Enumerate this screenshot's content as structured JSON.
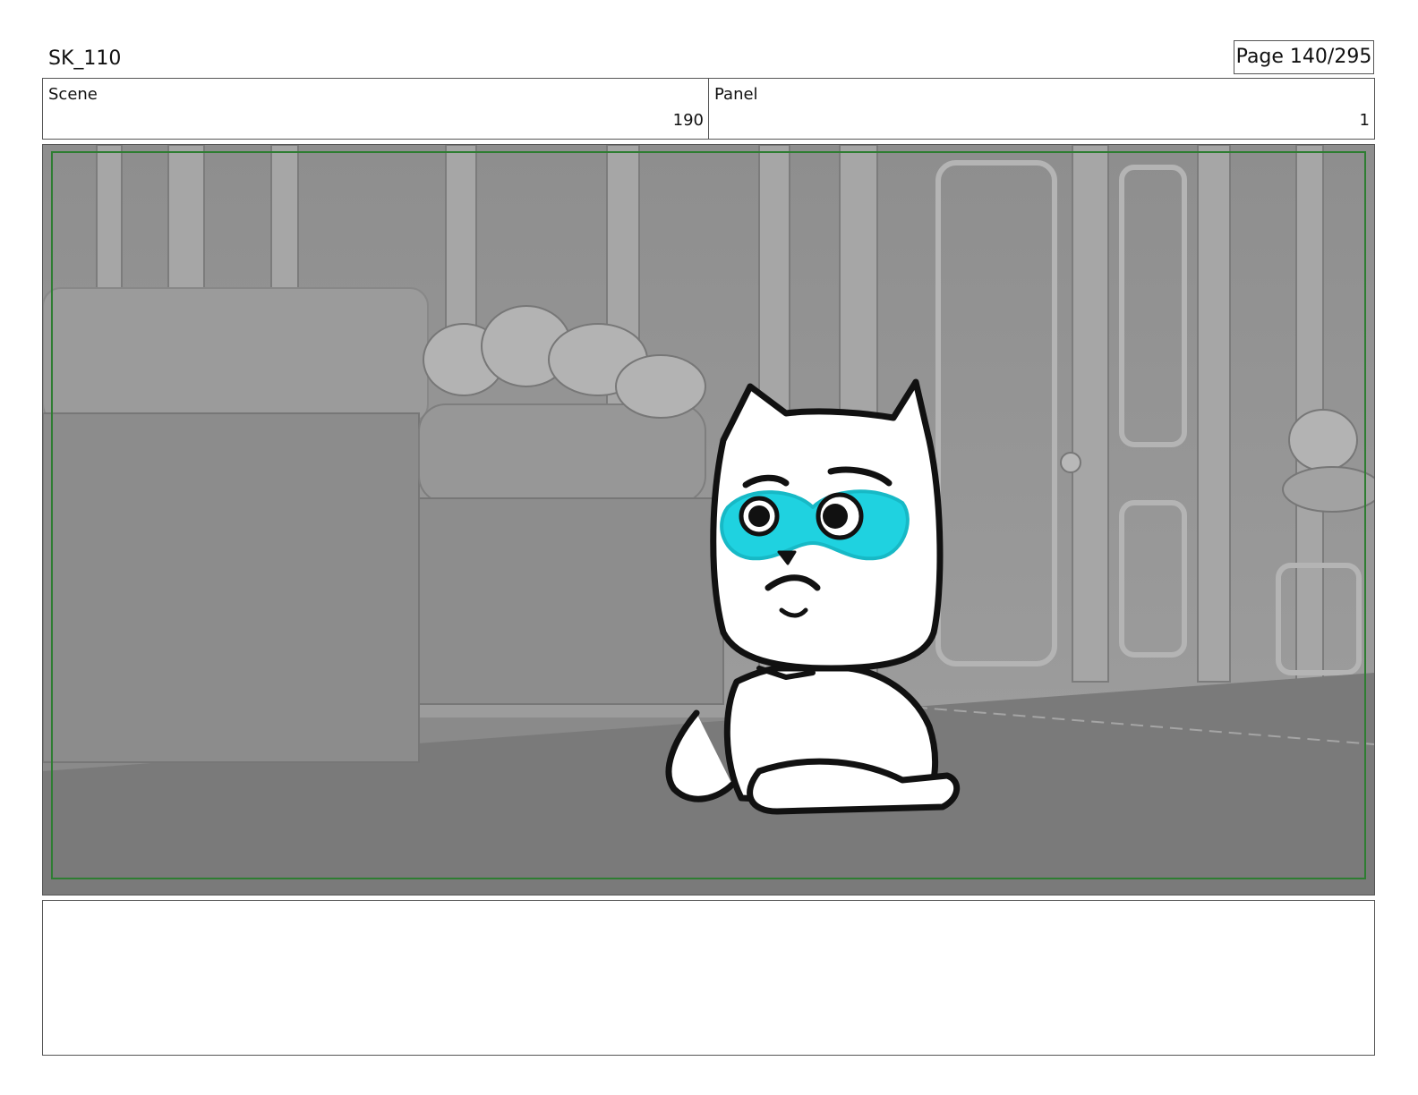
{
  "header": {
    "project_code": "SK_110",
    "page_label": "Page 140/295"
  },
  "info": {
    "scene_label": "Scene",
    "scene_value": "190",
    "panel_label": "Panel",
    "panel_value": "1"
  },
  "colors": {
    "safe_frame": "#2e7d32",
    "eye_mask": "#1fd2e0",
    "background_gray": "#8a8a8a"
  }
}
